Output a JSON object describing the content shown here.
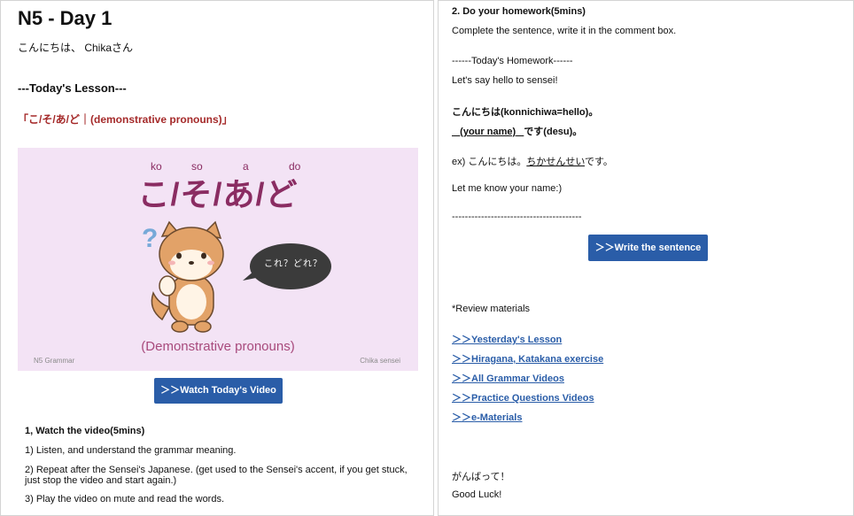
{
  "left": {
    "title": "N5 - Day 1",
    "greeting": "こんにちは、 Chikaさん",
    "lesson_heading": "---Today's Lesson---",
    "lesson_topic": "「こ/そ/あ/ど｜(demonstrative pronouns)」",
    "thumbnail": {
      "romaji": [
        "ko",
        "so",
        "a",
        "do"
      ],
      "kana": "こ/そ/あ/ど",
      "question_mark": "?",
      "bubble_text": "これ？どれ？",
      "caption": "(Demonstrative pronouns)",
      "footer_left": "N5 Grammar",
      "footer_right": "Chika sensei"
    },
    "watch_button": "＞＞Watch Today's Video",
    "watch_heading": "1, Watch the video(5mins)",
    "watch_items": [
      "1) Listen, and understand the grammar meaning.",
      "2) Repeat after the Sensei's Japanese. (get used to the Sensei's accent, if you get stuck, just stop the video and start again.)",
      "3) Play the video on mute and read the words."
    ]
  },
  "right": {
    "heading": "2. Do your homework(5mins)",
    "subtext": "Complete the sentence, write it in the comment box.",
    "homework_label": "------Today's Homework------",
    "hello_sensei": "Let's say hello to sensei!",
    "konnichiwa": "こんにちは(konnichiwa=hello)。",
    "name_blank": "(your name)",
    "desu": "です(desu)。",
    "example_prefix": "ex) こんにちは。",
    "example_name": "ちかせんせい",
    "example_suffix": "です。",
    "let_me_know": "Let me know your name:)",
    "divider": "----------------------------------------",
    "write_button": "＞＞Write the sentence",
    "review_label": "*Review materials",
    "links": [
      "＞＞Yesterday's Lesson",
      "＞＞Hiragana, Katakana exercise",
      "＞＞All Grammar Videos",
      "＞＞Practice Questions Videos",
      "＞＞e-Materials"
    ],
    "gambatte": "がんばって！",
    "good_luck": "Good Luck!"
  },
  "colors": {
    "accent_blue": "#2a5da8",
    "topic_red": "#a52a2a",
    "thumb_bg": "#f3e3f5",
    "kana_color": "#8a2c62"
  }
}
